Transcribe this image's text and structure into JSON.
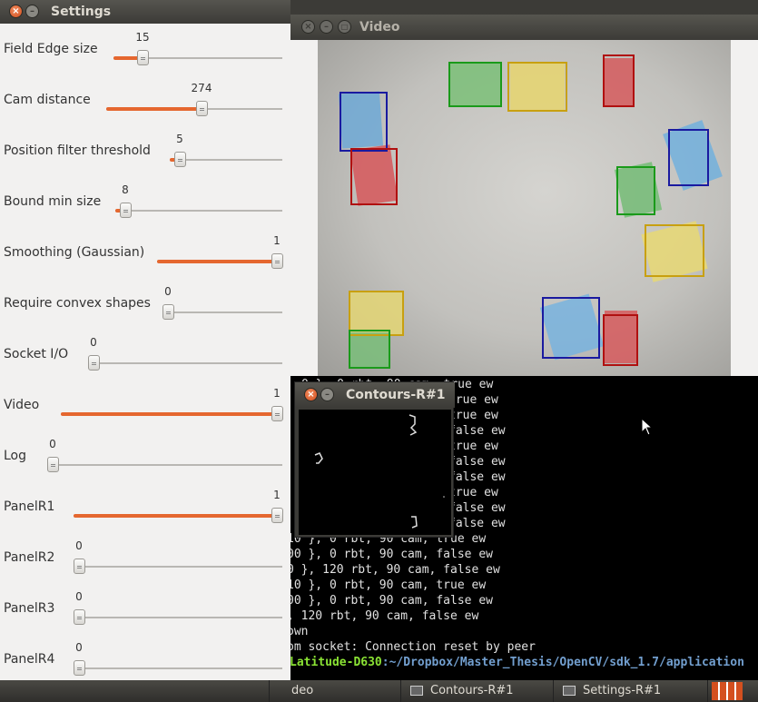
{
  "settings": {
    "title": "Settings",
    "sliders": [
      {
        "label": "Field Edge size",
        "value": "15"
      },
      {
        "label": "Cam distance",
        "value": "274"
      },
      {
        "label": "Position filter threshold",
        "value": "5"
      },
      {
        "label": "Bound min size",
        "value": "8"
      },
      {
        "label": "Smoothing (Gaussian)",
        "value": "1"
      },
      {
        "label": "Require convex shapes",
        "value": "0"
      },
      {
        "label": "Socket I/O",
        "value": "0"
      },
      {
        "label": "Video",
        "value": "1"
      },
      {
        "label": "Log",
        "value": "0"
      },
      {
        "label": "PanelR1",
        "value": "1"
      },
      {
        "label": "PanelR2",
        "value": "0"
      },
      {
        "label": "PanelR3",
        "value": "0"
      },
      {
        "label": "PanelR4",
        "value": "0"
      }
    ]
  },
  "video": {
    "title": "Video"
  },
  "contours": {
    "title": "Contours-R#1"
  },
  "terminal": {
    "lines": [
      "0 }, 0 rbt, 90 cam, true ew",
      "true ew",
      "true ew",
      "false ew",
      "true ew",
      "false ew",
      "false ew",
      "true ew",
      "false ew",
      "false ew",
      "10 }, 0 rbt, 90 cam, true ew",
      "00 }, 0 rbt, 90 cam, false ew",
      "0 }, 120 rbt, 90 cam, false ew",
      "10 }, 0 rbt, 90 cam, true ew",
      "00 }, 0 rbt, 90 cam, false ew",
      ", 120 rbt, 90 cam, false ew",
      "own",
      "om socket: Connection reset by peer"
    ],
    "prompt_host": "Latitude-D630",
    "prompt_path": ":~/Dropbox/Master_Thesis/OpenCV/sdk_1.7/application"
  },
  "taskbar": {
    "items": [
      "deo",
      "Contours-R#1",
      "Settings-R#1"
    ]
  },
  "colors": {
    "accent": "#e5672f",
    "red": "#b01010",
    "blue": "#1a1aa0",
    "green": "#1a9a1a",
    "yellow": "#c8a010"
  }
}
